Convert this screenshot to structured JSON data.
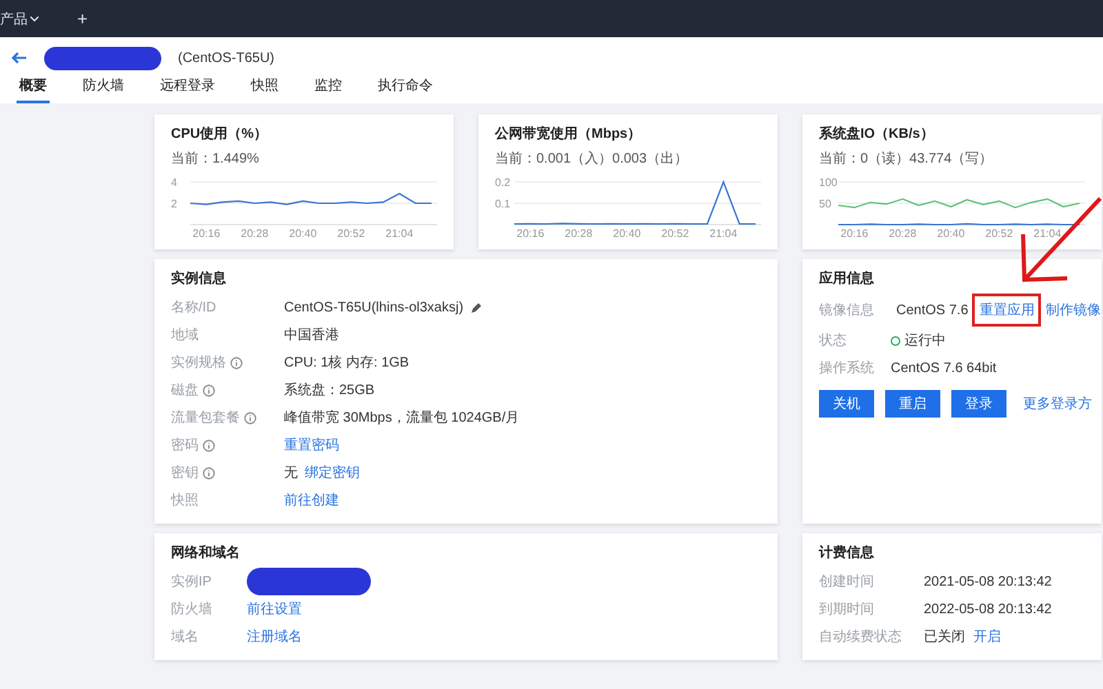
{
  "top_bar": {
    "menu": "产品",
    "add": "+"
  },
  "header": {
    "subtitle": "(CentOS-T65U)"
  },
  "tabs": [
    {
      "label": "概要",
      "selected": true
    },
    {
      "label": "防火墙",
      "selected": false
    },
    {
      "label": "远程登录",
      "selected": false
    },
    {
      "label": "快照",
      "selected": false
    },
    {
      "label": "监控",
      "selected": false
    },
    {
      "label": "执行命令",
      "selected": false
    }
  ],
  "metrics": [
    {
      "title": "CPU使用（%）",
      "current": "当前：1.449%",
      "chart_data": {
        "type": "line",
        "categories": [
          null,
          "20:16",
          null,
          null,
          "20:28",
          null,
          null,
          "20:40",
          null,
          null,
          "20:52",
          null,
          null,
          "21:04",
          null,
          null
        ],
        "yticks": [
          2,
          4
        ],
        "ylim": [
          0,
          4
        ],
        "series": [
          {
            "color": "#3a74d1",
            "values": [
              2,
              1.9,
              2.1,
              2.2,
              2,
              2.1,
              1.9,
              2.2,
              2,
              2,
              2.1,
              2,
              2.1,
              2.9,
              2,
              2
            ]
          }
        ]
      }
    },
    {
      "title": "公网带宽使用（Mbps）",
      "current": "当前：0.001（入）0.003（出）",
      "chart_data": {
        "type": "line",
        "categories": [
          null,
          "20:16",
          null,
          null,
          "20:28",
          null,
          null,
          "20:40",
          null,
          null,
          "20:52",
          null,
          null,
          "21:04",
          null,
          null
        ],
        "yticks": [
          0.1,
          0.2
        ],
        "ylim": [
          0,
          0.2
        ],
        "series": [
          {
            "color": "#3a74d1",
            "values": [
              0.003,
              0.004,
              0.003,
              0.005,
              0.004,
              0.003,
              0.004,
              0.003,
              0.004,
              0.003,
              0.004,
              0.003,
              0.003,
              0.2,
              0.004,
              0.003
            ]
          }
        ]
      }
    },
    {
      "title": "系统盘IO（KB/s）",
      "current": "当前：0（读）43.774（写）",
      "chart_data": {
        "type": "line",
        "categories": [
          null,
          "20:16",
          null,
          null,
          "20:28",
          null,
          null,
          "20:40",
          null,
          null,
          "20:52",
          null,
          null,
          "21:04",
          null,
          null
        ],
        "yticks": [
          50,
          100
        ],
        "ylim": [
          0,
          100
        ],
        "series": [
          {
            "color": "#5cc47a",
            "values": [
              45,
              40,
              52,
              48,
              60,
              45,
              55,
              42,
              58,
              47,
              55,
              40,
              52,
              60,
              42,
              50
            ]
          },
          {
            "color": "#3a74d1",
            "values": [
              0,
              0,
              1,
              0,
              0,
              1,
              0,
              0,
              2,
              0,
              0,
              1,
              0,
              1,
              0,
              0
            ]
          }
        ]
      }
    }
  ],
  "instance_info": {
    "title": "实例信息",
    "rows": [
      {
        "label": "名称/ID",
        "info": false,
        "kind": "editable",
        "value": "CentOS-T65U(lhins-ol3xaksj)"
      },
      {
        "label": "地域",
        "info": false,
        "kind": "text",
        "value": "中国香港"
      },
      {
        "label": "实例规格",
        "info": true,
        "kind": "text",
        "value": "CPU: 1核 内存: 1GB"
      },
      {
        "label": "磁盘",
        "info": true,
        "kind": "text",
        "value": "系统盘：25GB"
      },
      {
        "label": "流量包套餐",
        "info": true,
        "kind": "text",
        "value": "峰值带宽 30Mbps，流量包 1024GB/月"
      },
      {
        "label": "密码",
        "info": true,
        "kind": "link",
        "link": "重置密码"
      },
      {
        "label": "密钥",
        "info": true,
        "kind": "text_link",
        "value": "无",
        "link": "绑定密钥"
      },
      {
        "label": "快照",
        "info": false,
        "kind": "link",
        "link": "前往创建"
      }
    ]
  },
  "app_info": {
    "title": "应用信息",
    "image_label": "镜像信息",
    "image_name": "CentOS 7.6",
    "reset_link": "重置应用",
    "make_link": "制作镜像",
    "status_label": "状态",
    "status": {
      "text": "运行中",
      "kind": "running"
    },
    "os_label": "操作系统",
    "os": "CentOS 7.6 64bit",
    "buttons": [
      "关机",
      "重启",
      "登录"
    ],
    "more_link": "更多登录方"
  },
  "network": {
    "title": "网络和域名",
    "rows": [
      {
        "label": "实例IP",
        "kind": "redacted"
      },
      {
        "label": "防火墙",
        "kind": "link",
        "link": "前往设置"
      },
      {
        "label": "域名",
        "kind": "link",
        "link": "注册域名"
      }
    ]
  },
  "billing": {
    "title": "计费信息",
    "rows": [
      {
        "label": "创建时间",
        "value": "2021-05-08 20:13:42"
      },
      {
        "label": "到期时间",
        "value": "2022-05-08 20:13:42"
      },
      {
        "label": "自动续费状态",
        "value": "已关闭",
        "link": "开启"
      }
    ]
  }
}
